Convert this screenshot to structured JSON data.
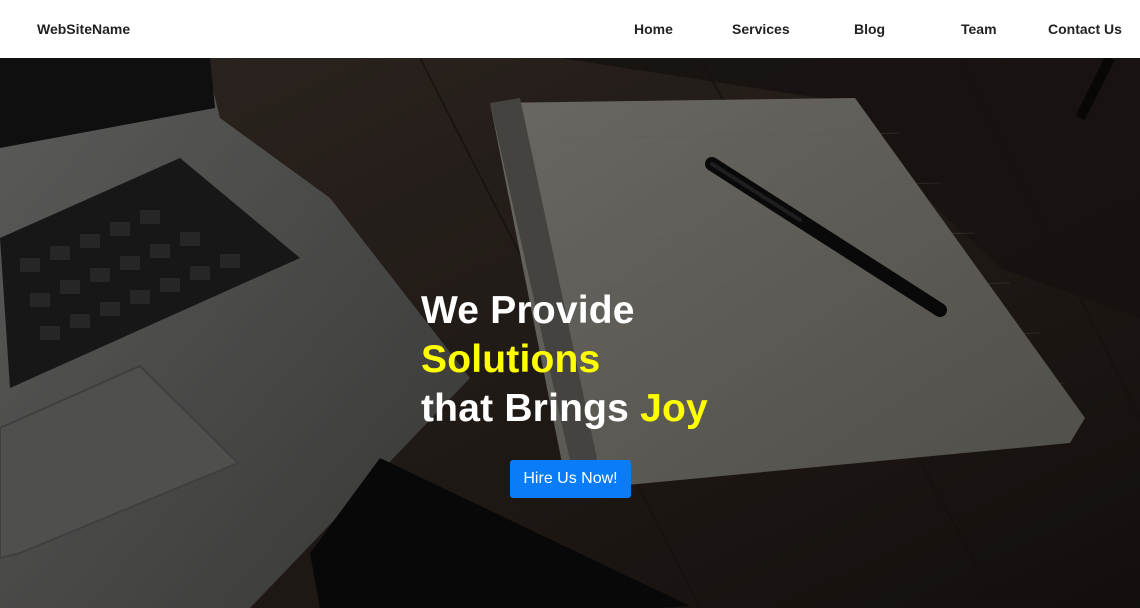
{
  "navbar": {
    "brand": "WebSiteName",
    "links": [
      "Home",
      "Services",
      "Blog",
      "Team",
      "Contact Us"
    ]
  },
  "hero": {
    "line1": "We Provide",
    "line2_accent": "Solutions",
    "line3_prefix": "that Brings ",
    "line3_accent": "Joy",
    "cta_label": "Hire Us Now!",
    "accent_color": "#ffff00",
    "cta_color": "#0a7cf8"
  }
}
